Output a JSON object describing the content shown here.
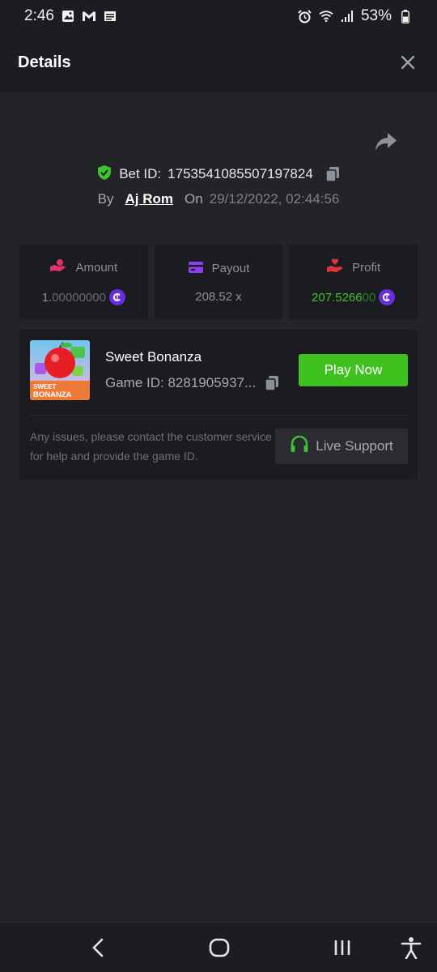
{
  "status_bar": {
    "time": "2:46",
    "battery": "53%",
    "left_icons": [
      "image-icon",
      "gmail-icon",
      "news-icon"
    ],
    "right_icons": [
      "alarm-icon",
      "wifi-icon",
      "signal-icon",
      "battery-icon"
    ]
  },
  "header": {
    "title": "Details",
    "close_icon": "close-icon"
  },
  "bet": {
    "label": "Bet ID:",
    "id": "1753541085507197824",
    "by_label": "By",
    "user": "Aj Rom",
    "on_label": "On",
    "date": "29/12/2022, 02:44:56"
  },
  "stats": {
    "amount": {
      "label": "Amount",
      "value_main": "1.",
      "value_dim": "00000000",
      "icon": "hand-coins-icon",
      "icon_color": "#e0356a"
    },
    "payout": {
      "label": "Payout",
      "value": "208.52 x",
      "icon": "card-icon",
      "icon_color": "#8d3cf0"
    },
    "profit": {
      "label": "Profit",
      "value_main": "207.5266",
      "value_dim": "00",
      "icon": "hand-heart-icon",
      "icon_color": "#e0353a"
    }
  },
  "game": {
    "name": "Sweet Bonanza",
    "id_label": "Game ID: 8281905937...",
    "thumb_text_1": "SWEET",
    "thumb_text_2": "BONANZA",
    "play_label": "Play Now",
    "issues_text": "Any issues, please contact the customer service for help and provide the game ID.",
    "support_label": "Live Support"
  },
  "colors": {
    "accent_green": "#3fc21f",
    "coin_purple": "#6a2ce0",
    "shield_green": "#3fc22f"
  }
}
